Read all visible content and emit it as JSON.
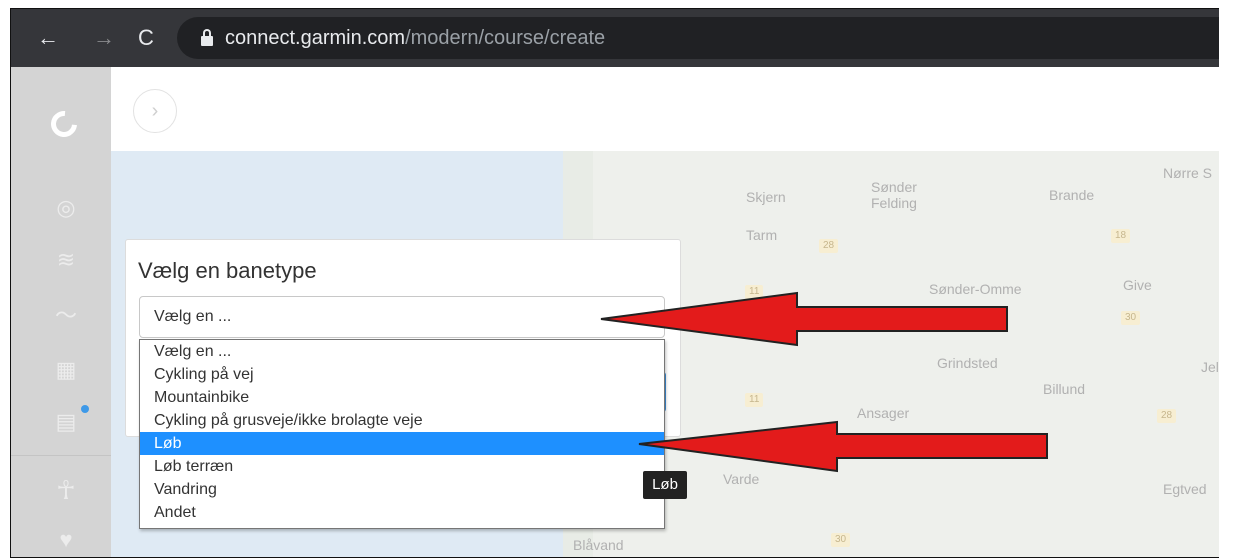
{
  "browser": {
    "url_host": "connect.garmin.com",
    "url_path": "/modern/course/create"
  },
  "map": {
    "towns": [
      "Skjern",
      "Sønder",
      "Felding",
      "Brande",
      "Nørre S",
      "Tarm",
      "Sønder-Omme",
      "Give",
      "Grindsted",
      "Billund",
      "Jel",
      "Ansager",
      "Varde",
      "Egtved",
      "Blåvand"
    ],
    "roads": [
      "28",
      "18",
      "11",
      "30",
      "11",
      "28",
      "30"
    ]
  },
  "course_form": {
    "title": "Vælg en banetype",
    "select_value": "Vælg en ...",
    "options": [
      "Vælg en ...",
      "Cykling på vej",
      "Mountainbike",
      "Cykling på grusveje/ikke brolagte veje",
      "Løb",
      "Løb terræn",
      "Vandring",
      "Andet"
    ],
    "highlighted_option": "Løb",
    "tooltip": "Løb"
  },
  "icons": {
    "back": "back-arrow-icon",
    "forward": "forward-arrow-icon",
    "reload": "reload-icon",
    "lock": "lock-icon",
    "logo": "garmin-connect-logo",
    "sidebar": [
      "dashboard-icon",
      "layers-icon",
      "activity-icon",
      "calendar-icon",
      "reports-icon",
      "running-person-icon",
      "heart-icon"
    ],
    "expand": "chevron-right-icon"
  },
  "colors": {
    "chrome_bar": "#35363a",
    "omnibox": "#202124",
    "sidebar": "#d4d4d4",
    "highlight": "#1e90ff",
    "arrow_fill": "#e31b1b"
  }
}
